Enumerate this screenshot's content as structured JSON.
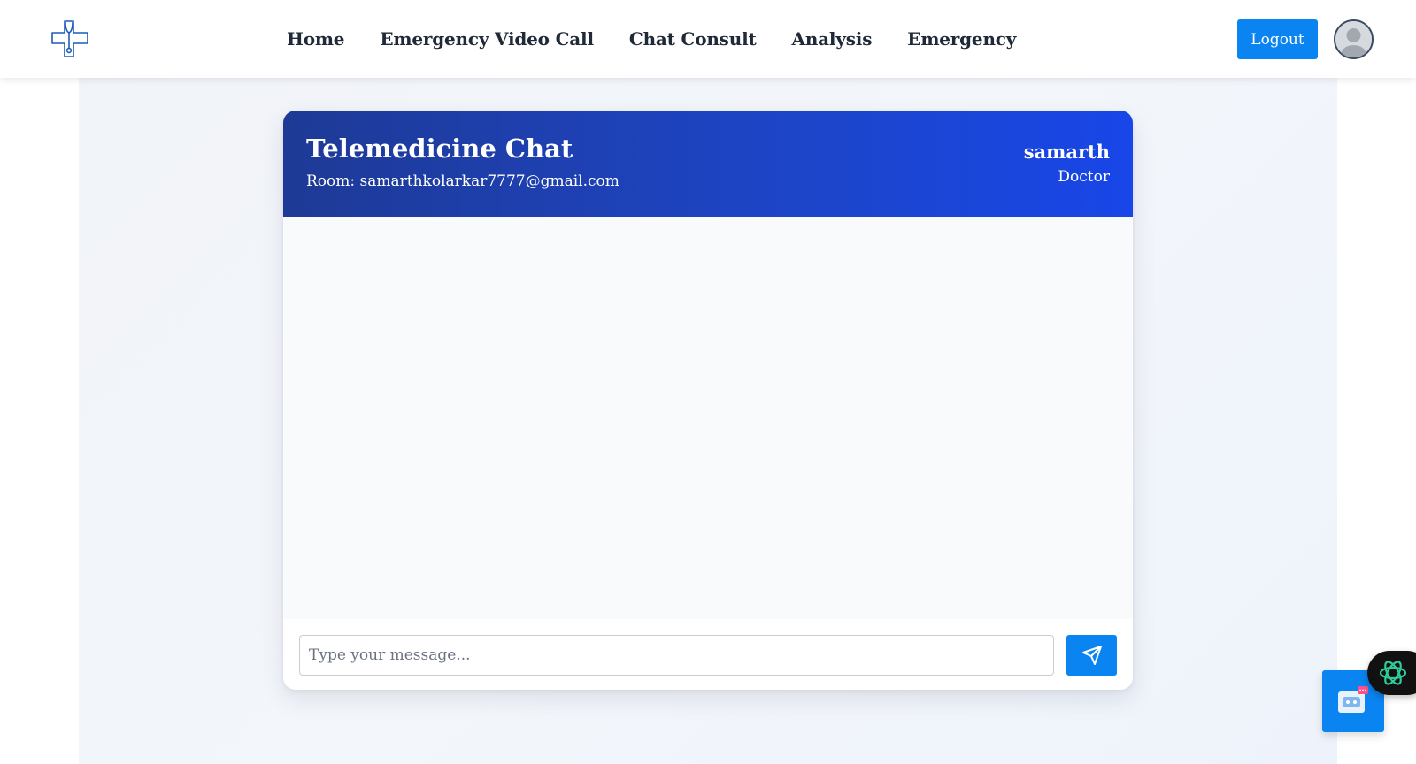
{
  "nav": {
    "logo_icon": "medical-cross-stethoscope-icon",
    "links": [
      {
        "label": "Home"
      },
      {
        "label": "Emergency Video Call"
      },
      {
        "label": "Chat Consult"
      },
      {
        "label": "Analysis"
      },
      {
        "label": "Emergency"
      }
    ],
    "logout_label": "Logout",
    "avatar_icon": "user-avatar-icon"
  },
  "chat": {
    "title": "Telemedicine Chat",
    "room": "Room: samarthkolarkar7777@gmail.com",
    "user_name": "samarth",
    "user_role": "Doctor",
    "messages": [],
    "input_placeholder": "Type your message...",
    "input_value": "",
    "send_icon": "send-paper-plane-icon"
  },
  "widgets": {
    "chatbot_icon": "chatbot-robot-icon",
    "ai_icon": "ai-assistant-icon"
  },
  "colors": {
    "accent": "#0a84f0",
    "header_gradient_start": "#1e3a96",
    "header_gradient_end": "#1846e8",
    "logo_blue": "#1e5bb8",
    "ai_green": "#2ecc9a"
  }
}
